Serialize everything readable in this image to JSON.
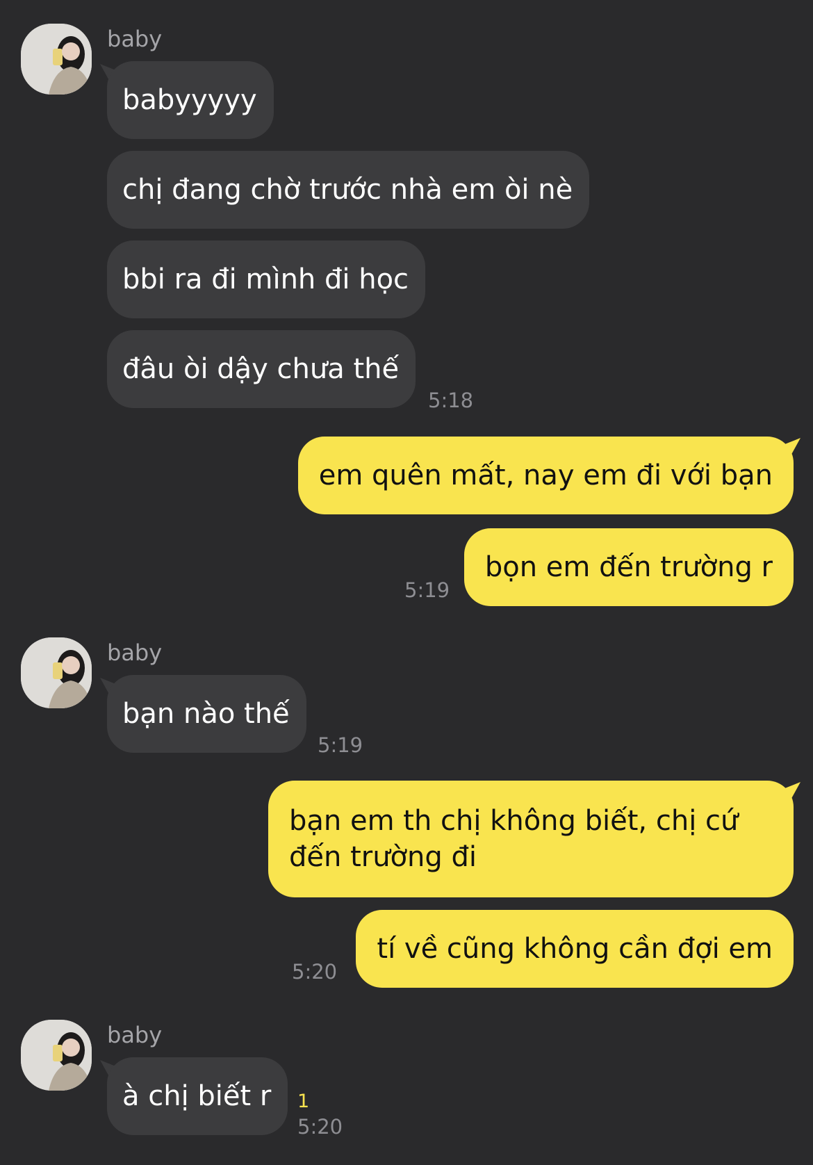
{
  "groups": [
    {
      "sender": "baby",
      "messages": [
        "babyyyyy",
        "chị đang chờ trước nhà em òi nè",
        "bbi ra đi mình đi học",
        "đâu òi dậy chưa thế"
      ],
      "time": "5:18"
    },
    {
      "outgoing": [
        "em quên mất, nay em đi với bạn",
        "bọn em đến trường r"
      ],
      "time": "5:19"
    },
    {
      "sender": "baby",
      "messages": [
        "bạn nào thế"
      ],
      "time": "5:19"
    },
    {
      "outgoing": [
        "bạn em th chị không biết, chị cứ đến trường đi",
        "tí về cũng không cần đợi em"
      ],
      "time": "5:20"
    },
    {
      "sender": "baby",
      "messages": [
        "à chị biết r"
      ],
      "unread": "1",
      "time": "5:20"
    }
  ],
  "colors": {
    "background": "#2a2a2c",
    "incoming_bubble": "#3c3c3e",
    "outgoing_bubble": "#f9e44f",
    "timestamp": "#8e8e93"
  },
  "icons": {
    "avatar": "profile-photo-avatar"
  }
}
